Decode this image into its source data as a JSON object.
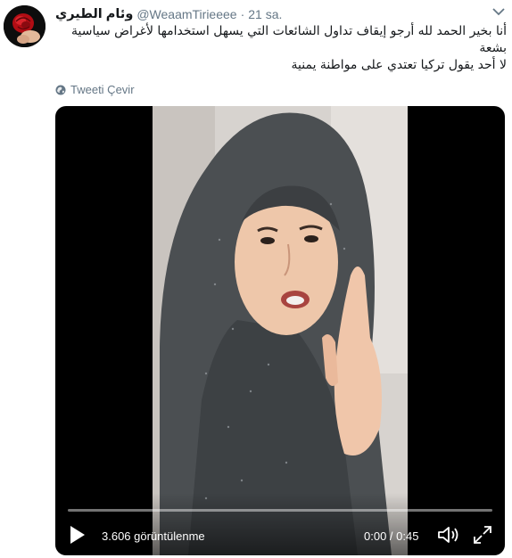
{
  "tweet": {
    "display_name": "وئام الطيري",
    "handle": "@WeaamTirieeee",
    "separator": "·",
    "time": "21 sa.",
    "text_lines": [
      "أنا بخير الحمد لله أرجو إيقاف تداول الشائعات التي يسهل استخدامها لأغراض سياسية بشعة",
      "لا أحد يقول تركيا تعتدي على مواطنة يمنية"
    ],
    "translate_label": "Tweeti Çevir",
    "icons": {
      "avatar": "rose-avatar",
      "menu": "chevron-down-icon",
      "translate": "globe-icon"
    }
  },
  "video": {
    "views_label": "3.606 görüntülenme",
    "time_label": "0:00 / 0:45",
    "progress": 0,
    "icons": {
      "play": "play-icon",
      "volume": "volume-icon",
      "fullscreen": "fullscreen-icon"
    }
  },
  "colors": {
    "text": "#14171a",
    "muted": "#657786",
    "video_bg": "#000000"
  }
}
